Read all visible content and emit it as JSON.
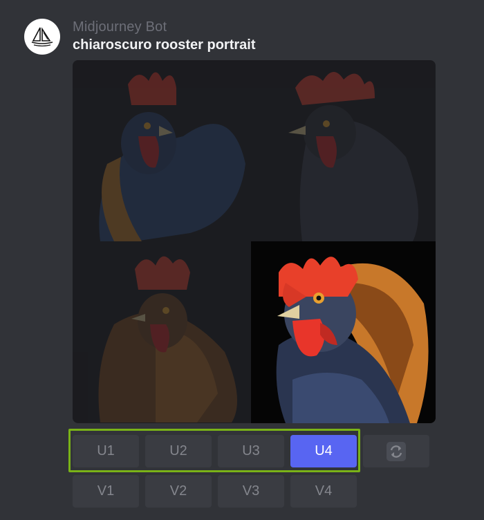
{
  "message": {
    "author": "Midjourney Bot",
    "prompt": "chiaroscuro rooster portrait",
    "avatar_icon": "sailboat-icon"
  },
  "image_grid": {
    "tiles": [
      "rooster-1",
      "rooster-2",
      "rooster-3",
      "rooster-4"
    ],
    "highlighted_tile": 4
  },
  "upscale_buttons": [
    "U1",
    "U2",
    "U3",
    "U4"
  ],
  "variation_buttons": [
    "V1",
    "V2",
    "V3",
    "V4"
  ],
  "active_button": "U4",
  "reroll_icon": "refresh-icon",
  "colors": {
    "background": "#313338",
    "button": "#3a3c42",
    "active_button": "#5865f2",
    "highlight_border": "#7ab317"
  }
}
